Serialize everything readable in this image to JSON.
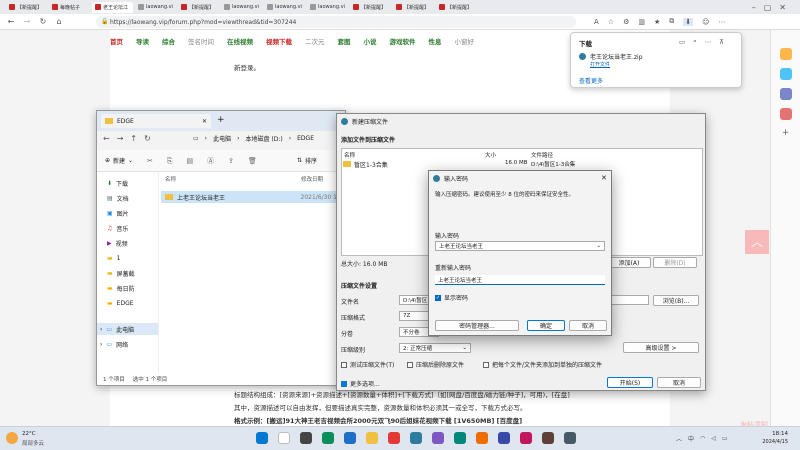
{
  "browser": {
    "tabs": [
      "【新提醒】",
      "每晚帖子",
      "老王论坛江",
      "laowang.vi",
      "【新提醒】",
      "laowang.vi",
      "laowang.vi",
      "laowang.vi",
      "【新提醒】",
      "【新提醒】",
      "【新提醒】"
    ],
    "url": "https://laowang.vip/forum.php?mod=viewthread&tid=307244"
  },
  "site": {
    "nav": [
      "首页",
      "导读",
      "综合",
      "签名时间",
      "在线视频",
      "视频下载",
      "二次元",
      "套图",
      "小说",
      "游戏软件",
      "性息",
      "小窗好"
    ],
    "line1": "新登录。",
    "line2": "标题结构组成：[资源来源]+资源描述+[资源数量+体积]+[下载方式]（如[网盘/百度盘/磁力链/种子]，可用)，[在盘]",
    "line3": "其中，资源描述可以自由发挥，但要描述真实完整，资源数量和体积必须其一或全写，下载方式必写。",
    "line4": "格式示例：[搬运]91大神王老吉视频会所2000元双飞90后姐妹花视频下载 [1V650MB] [百度盘]",
    "side_label": "发帖须知"
  },
  "download": {
    "title": "下载",
    "filename": "老王论坛当老王.zip",
    "open_file": "打开文件",
    "see_more": "查看更多"
  },
  "explorer": {
    "tab_title": "EDGE",
    "new_button": "新建",
    "sort_button": "排序",
    "breadcrumb": [
      "此电脑",
      "本地磁盘 (D:)",
      "EDGE"
    ],
    "col_name": "名称",
    "col_date": "修改日期",
    "sidebar": [
      "下载",
      "文档",
      "图片",
      "音乐",
      "视频",
      "1",
      "屏蓄截",
      "每日防",
      "EDGE",
      "此电脑",
      "网络"
    ],
    "file_name": "上老王论坛当老王",
    "file_date": "2021/6/30 1",
    "status_count": "1 个项目",
    "status_selected": "选中 1 个项目"
  },
  "zip": {
    "title": "新建压缩文件",
    "heading": "添加文件到压缩文件",
    "col_name": "名称",
    "col_size": "大小",
    "col_path": "文件路径",
    "file_name": "暂区1-3合集",
    "file_size": "16.0 MB",
    "file_path": "D:\\4\\暂区1-3合集",
    "total": "总大小: 16.0 MB",
    "add_button": "添加(A)",
    "delete_button": "删除(D)",
    "settings_heading": "压缩文件设置",
    "label_filename": "文件名",
    "filename_value": "D:\\4\\暂区1",
    "label_format": "压缩格式",
    "format_value": "7Z",
    "label_volume": "分卷",
    "volume_value": "不分卷",
    "label_level": "压缩级别",
    "level_value": "2: 正常压缩",
    "browse_button": "浏览(B)...",
    "advanced_button": "高级设置 >",
    "cb_test": "测试压缩文件(T)",
    "cb_delete": "压缩后删除原文件",
    "cb_separate": "把每个文件/文件夹添加到单独的压缩文件",
    "more_options": "更多选项...",
    "start_button": "开始(S)",
    "cancel_button": "取消"
  },
  "pwd": {
    "title": "输入密码",
    "hint": "输入压缩密码。建议使用至少 8 位的密码来保证安全性。",
    "label_enter": "输入密码",
    "value_enter": "上老王论坛当老王",
    "label_reenter": "重新输入密码",
    "value_reenter": "上老王论坛当老王",
    "show_password": "显示密码",
    "manager_button": "密码管理器...",
    "ok_button": "确定",
    "cancel_button": "取消"
  },
  "taskbar": {
    "temp": "22°C",
    "weather": "局部多云",
    "time": "18:14",
    "date": "2024/4/15"
  }
}
